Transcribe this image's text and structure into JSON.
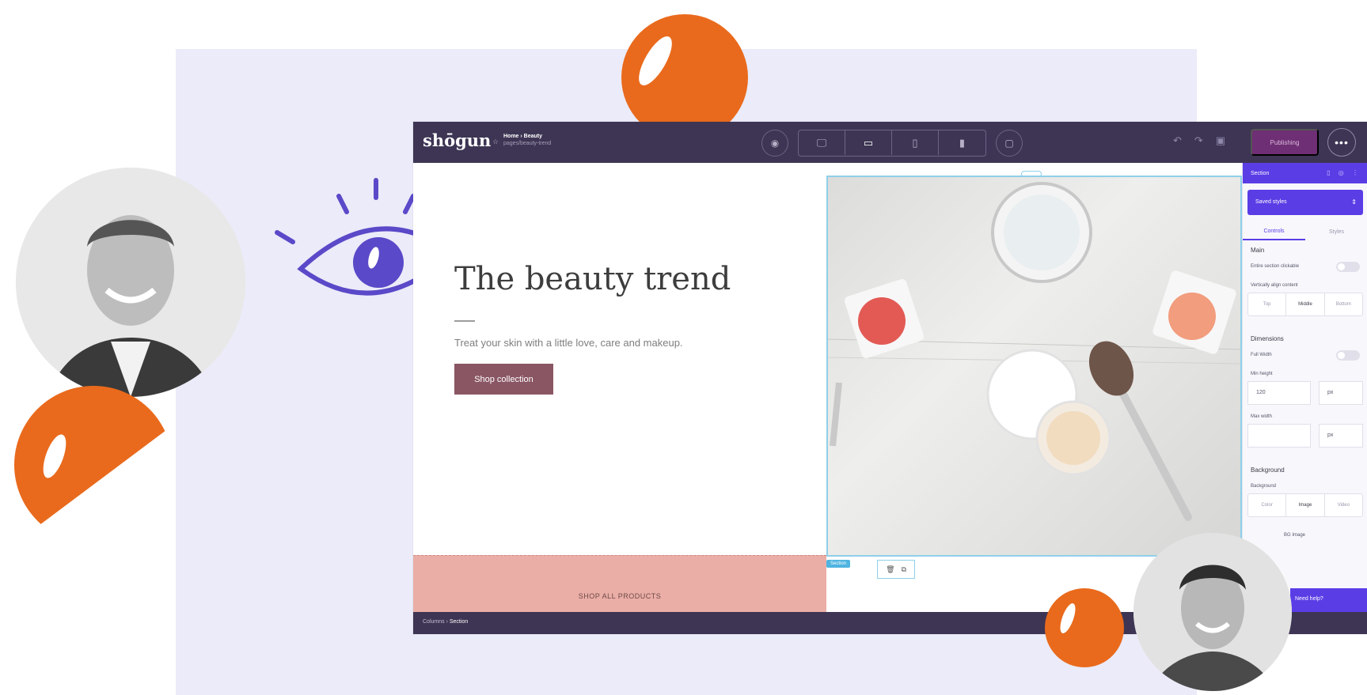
{
  "app": {
    "logo": "shōgun",
    "page_name": "Home › Beauty",
    "page_url": "pages/beauty-trend"
  },
  "toolbar": {
    "publish_label": "Publishing",
    "more_label": "•••"
  },
  "hero": {
    "title": "The beauty trend",
    "subtitle": "Treat your skin with a little love, care and makeup.",
    "button_label": "Shop collection"
  },
  "footer_banner": {
    "text": "SHOP ALL PRODUCTS"
  },
  "selection": {
    "label": "Section",
    "tools": [
      "🗑",
      "⧉"
    ]
  },
  "breadcrumb": {
    "root": "Columns",
    "current": "Section"
  },
  "panel": {
    "header": "Section",
    "select_value": "Saved styles",
    "tabs": [
      "Controls",
      "Styles"
    ],
    "main": {
      "title": "Main",
      "clickable_label": "Entire section clickable",
      "align_label": "Vertically align content",
      "align_options": [
        "Top",
        "Middle",
        "Bottom"
      ]
    },
    "dimensions": {
      "title": "Dimensions",
      "full_width_label": "Full Width",
      "min_height_label": "Min height",
      "min_height_value": "120",
      "min_height_unit": "px",
      "max_width_label": "Max width",
      "max_width_unit": "px"
    },
    "background": {
      "title": "Background",
      "label": "Background",
      "options": [
        "Color",
        "Image",
        "Video"
      ],
      "image_label": "BG Image"
    },
    "help": "Need help?"
  },
  "colors": {
    "topbar": "#3d3553",
    "accent": "#5b3de6",
    "button": "#8a5663",
    "banner": "#eaaea6",
    "orange": "#e96a1c"
  }
}
